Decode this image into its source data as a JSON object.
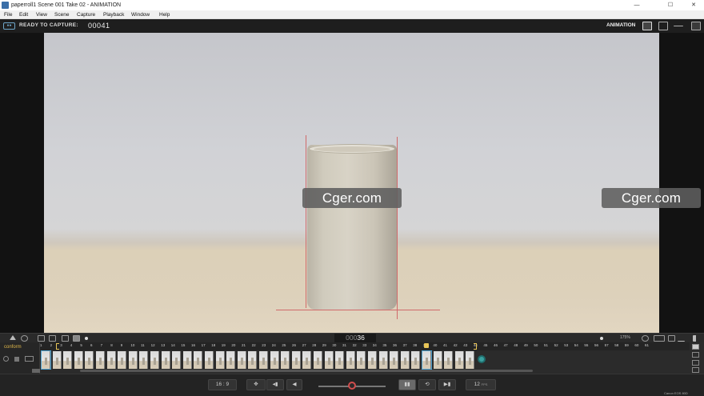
{
  "window": {
    "title": "paperroll1  Scene 001  Take 02 - ANIMATION",
    "minimize_glyph": "—",
    "maximize_glyph": "☐",
    "close_glyph": "✕"
  },
  "menu": [
    "File",
    "Edit",
    "View",
    "Scene",
    "Capture",
    "Playback",
    "Window",
    "Help"
  ],
  "capture_bar": {
    "status": "READY TO CAPTURE:",
    "frame_number": "00041",
    "mode": "ANIMATION"
  },
  "viewer": {
    "watermarks": [
      "Cger.com",
      "Cger.com"
    ]
  },
  "timeline_tools": {
    "counter_prefix": "000",
    "counter_current": "36",
    "zoom": "175%"
  },
  "track": {
    "label": "conform",
    "ruler_numbers": [
      "1",
      "2",
      "3",
      "4",
      "5",
      "6",
      "7",
      "8",
      "9",
      "10",
      "11",
      "12",
      "13",
      "14",
      "15",
      "16",
      "17",
      "18",
      "19",
      "20",
      "21",
      "22",
      "23",
      "24",
      "25",
      "26",
      "27",
      "28",
      "29",
      "30",
      "31",
      "32",
      "33",
      "34",
      "35",
      "36",
      "37",
      "38",
      "39",
      "40",
      "41",
      "42",
      "43",
      "44",
      "45",
      "46",
      "47",
      "48",
      "49",
      "50",
      "51",
      "52",
      "53",
      "54",
      "55",
      "56",
      "57",
      "58",
      "59",
      "60",
      "61"
    ],
    "captured_frames": 40
  },
  "bottom_bar": {
    "aspect_ratio": "16 : 9",
    "fps_value": "12",
    "fps_unit": "FPS",
    "camera": "Canon EOS 80D"
  },
  "colors": {
    "accent_red": "#d14d4d",
    "conform_label": "#e0b84a",
    "capture_icon": "#6fa6c9"
  }
}
